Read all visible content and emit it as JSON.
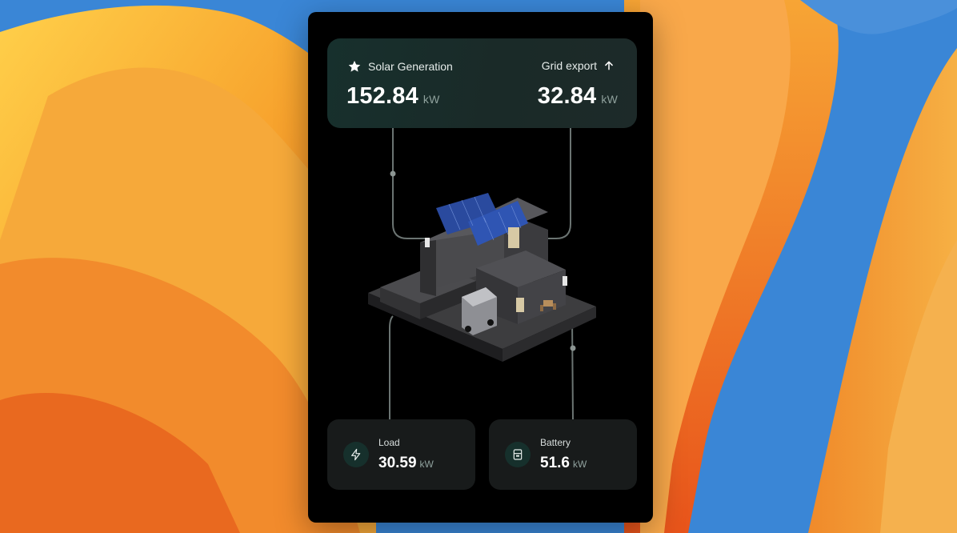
{
  "colors": {
    "panel": "#000000",
    "card_top": "#17302d",
    "card_bottom": "#181b1b",
    "accent": "#16302c",
    "line": "#6b7472"
  },
  "solar": {
    "label": "Solar Generation",
    "value": "152.84",
    "unit": "kW",
    "icon": "star-icon"
  },
  "grid": {
    "label": "Grid export",
    "value": "32.84",
    "unit": "kW",
    "icon": "arrow-up-icon"
  },
  "load": {
    "label": "Load",
    "value": "30.59",
    "unit": "kW",
    "icon": "lightning-icon"
  },
  "battery": {
    "label": "Battery",
    "value": "51.6",
    "unit": "kW",
    "icon": "battery-icon"
  }
}
